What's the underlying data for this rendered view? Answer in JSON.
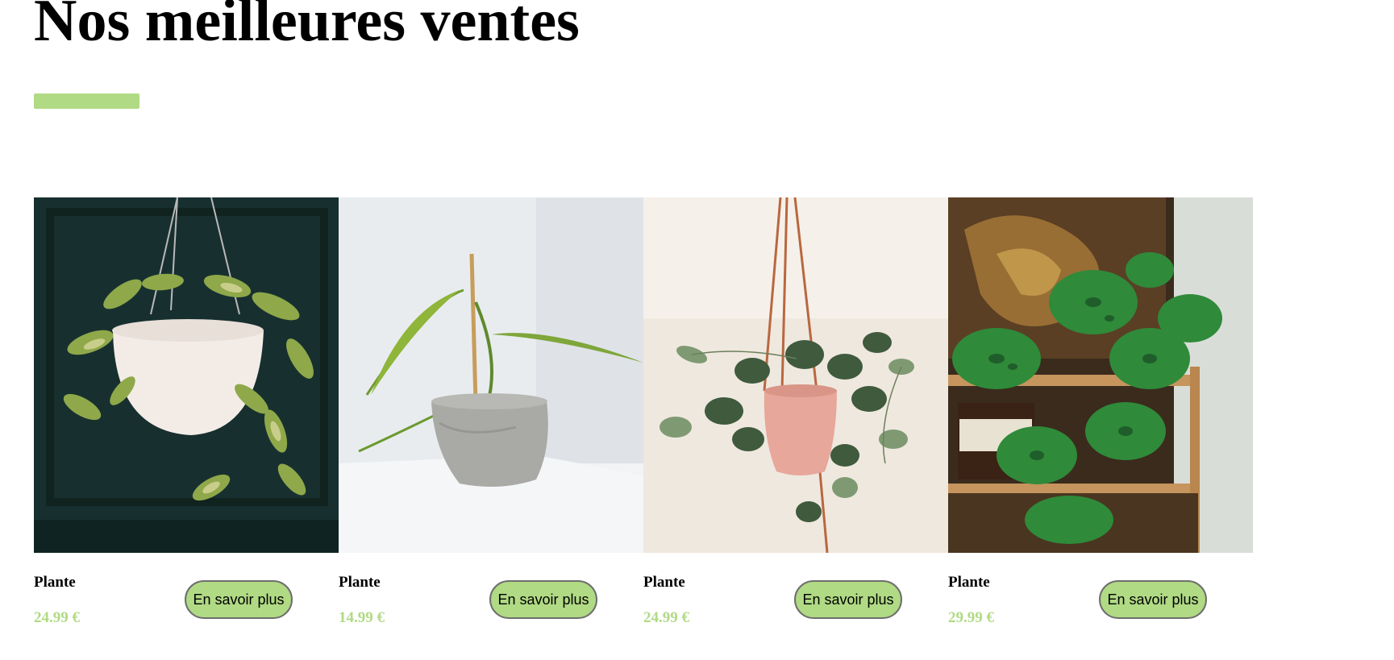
{
  "page": {
    "title": "Nos meilleures ventes",
    "accent_color": "#b0da84"
  },
  "products": [
    {
      "name": "Plante",
      "price": "24.99 €",
      "button_label": "En savoir plus",
      "image": "hanging-hoya-white-pot-photo"
    },
    {
      "name": "Plante",
      "price": "14.99 €",
      "button_label": "En savoir plus",
      "image": "potted-plant-gray-pot-photo"
    },
    {
      "name": "Plante",
      "price": "24.99 €",
      "button_label": "En savoir plus",
      "image": "hanging-pothos-pink-pot-photo"
    },
    {
      "name": "Plante",
      "price": "29.99 €",
      "button_label": "En savoir plus",
      "image": "monstera-on-shelf-photo"
    }
  ]
}
